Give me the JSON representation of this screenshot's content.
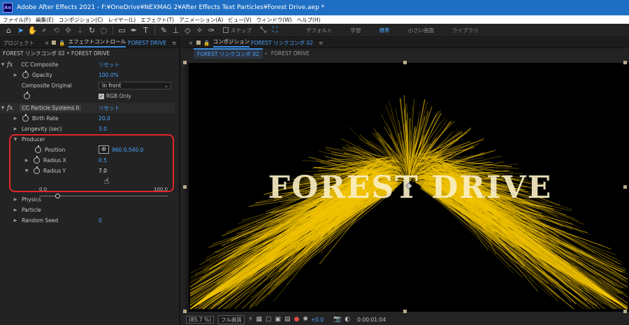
{
  "window": {
    "title": "Adobe After Effects 2021 - F:¥OneDrive¥NEXMAG 2¥After Effects Text Particles¥Forest Drive.aep *",
    "logo_text": "Ae"
  },
  "menu": [
    "ファイル(F)",
    "編集(E)",
    "コンポジション(C)",
    "レイヤー(L)",
    "エフェクト(T)",
    "アニメーション(A)",
    "ビュー(V)",
    "ウィンドウ(W)",
    "ヘルプ(H)"
  ],
  "toolbar": {
    "snap_label": "スナップ",
    "workspaces": [
      "デフォルト",
      "学習",
      "標準",
      "小さい画面",
      "ライブラリ"
    ],
    "active_workspace": "標準"
  },
  "left_panel": {
    "tab_project": "プロジェクト",
    "tab_effect_controls": "エフェクトコントロール",
    "tab_layer": "FOREST DRIVE",
    "menu_icon": "≡",
    "subheader": "FOREST リンクコンポ 02 • FOREST DRIVE",
    "cc_composite": {
      "name": "CC Composite",
      "reset": "リセット",
      "opacity_label": "Opacity",
      "opacity_value": "100.0%",
      "composite_original_label": "Composite Original",
      "composite_original_value": "In front",
      "rgb_only_label": "RGB Only"
    },
    "cc_particle": {
      "name": "CC Particle Systems II",
      "reset": "リセット",
      "birth_rate_label": "Birth Rate",
      "birth_rate_value": "20.0",
      "longevity_label": "Longevity (sec)",
      "longevity_value": "3.0",
      "producer_label": "Producer",
      "position_label": "Position",
      "position_value": "960.0,540.0",
      "radius_x_label": "Radius X",
      "radius_x_value": "0.5",
      "radius_y_label": "Radius Y",
      "radius_y_value": "7.0",
      "slider_min": "0.0",
      "slider_max": "100.0",
      "radius_y_fraction": 0.07,
      "physics_label": "Physics",
      "particle_label": "Particle",
      "random_seed_label": "Random Seed",
      "random_seed_value": "0"
    }
  },
  "right_panel": {
    "tab_composition": "コンポジション",
    "tab_comp_name": "FOREST リンクコンポ 02",
    "menu_icon": "≡",
    "comp_tab_1": "FOREST リンクコンポ 02",
    "comp_tab_2": "FOREST DRIVE",
    "viewer_text": "FOREST DRIVE",
    "zoom": "(85.7 %)",
    "resolution": "フル画質",
    "exposure": "+0.0",
    "timecode": "0:00:01:04"
  },
  "colors": {
    "titlebar": "#1f6fc4",
    "accent": "#4aa3ff",
    "highlight_box": "#e0262a",
    "particle": "#f2c400"
  }
}
